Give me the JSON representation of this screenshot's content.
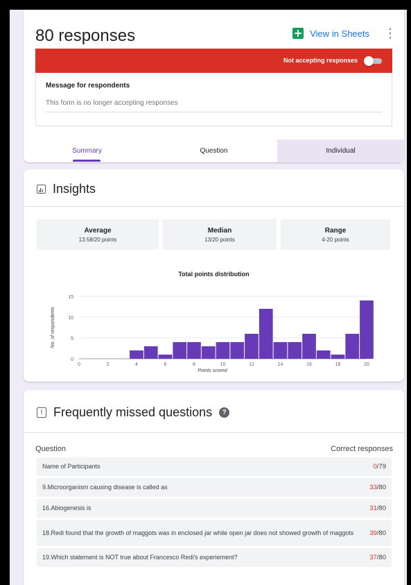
{
  "header": {
    "responses_title": "80 responses",
    "view_in_sheets": "View in Sheets",
    "more_icon": "more-vert-icon",
    "not_accepting_label": "Not accepting responses",
    "accepting_toggle_on": false
  },
  "message": {
    "label": "Message for respondents",
    "text": "This form is no longer accepting responses"
  },
  "tabs": [
    {
      "label": "Summary",
      "active": true
    },
    {
      "label": "Question",
      "active": false
    },
    {
      "label": "Individual",
      "active": false
    }
  ],
  "insights": {
    "title": "Insights",
    "stats": [
      {
        "title": "Average",
        "value": "13.58/20 points"
      },
      {
        "title": "Median",
        "value": "13/20 points"
      },
      {
        "title": "Range",
        "value": "4-20 points"
      }
    ]
  },
  "chart_data": {
    "type": "bar",
    "title": "Total points distribution",
    "xlabel": "Points scored",
    "ylabel": "No. of respondents",
    "x": [
      4,
      5,
      6,
      7,
      8,
      9,
      10,
      11,
      12,
      13,
      14,
      15,
      16,
      17,
      18,
      19,
      20
    ],
    "values": [
      2,
      3,
      1,
      4,
      4,
      3,
      4,
      4,
      6,
      12,
      4,
      4,
      6,
      2,
      1,
      6,
      14
    ],
    "xlim": [
      0,
      20
    ],
    "ylim": [
      0,
      15
    ],
    "xticks": [
      0,
      2,
      4,
      6,
      8,
      10,
      12,
      14,
      16,
      18,
      20
    ],
    "yticks": [
      0,
      5,
      10,
      15
    ],
    "bar_color": "#673ab7",
    "grid": true
  },
  "missed": {
    "title": "Frequently missed questions",
    "col_question": "Question",
    "col_correct": "Correct responses",
    "rows": [
      {
        "question": "Name of Participants",
        "correct": "0",
        "total": "/79"
      },
      {
        "question": "9.Microorganism causing disease is called as",
        "correct": "33",
        "total": "/80"
      },
      {
        "question": "16.Abiogenesis is",
        "correct": "31",
        "total": "/80"
      },
      {
        "question": "18.Redi found that the growth of maggots was in enclosed jar while open jar does not showed growth of maggots",
        "correct": "39",
        "total": "/80"
      },
      {
        "question": "19.Which statement is NOT true about Francesco Redi's experiement?",
        "correct": "37",
        "total": "/80"
      }
    ]
  },
  "colors": {
    "accent": "#673ab7",
    "alert_red": "#d93025",
    "link_blue": "#1a73e8",
    "sheets_green": "#0f9d58"
  }
}
